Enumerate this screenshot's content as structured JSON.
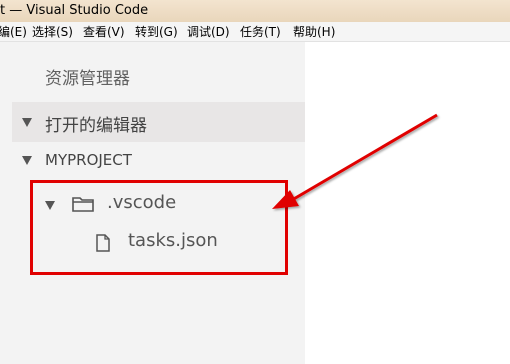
{
  "window": {
    "title": "t — Visual Studio Code"
  },
  "menu": {
    "items": [
      {
        "label": "编(E)"
      },
      {
        "label": "选择(S)"
      },
      {
        "label": "查看(V)"
      },
      {
        "label": "转到(G)"
      },
      {
        "label": "调试(D)"
      },
      {
        "label": "任务(T)"
      },
      {
        "label": "帮助(H)"
      }
    ]
  },
  "sidebar": {
    "title": "资源管理器",
    "open_editors_label": "打开的编辑器",
    "project_label": "MYPROJECT",
    "folder": {
      "name": ".vscode"
    },
    "file": {
      "name": "tasks.json"
    }
  },
  "annotation": {
    "box_color": "#e00000",
    "arrow_color": "#e00000"
  }
}
